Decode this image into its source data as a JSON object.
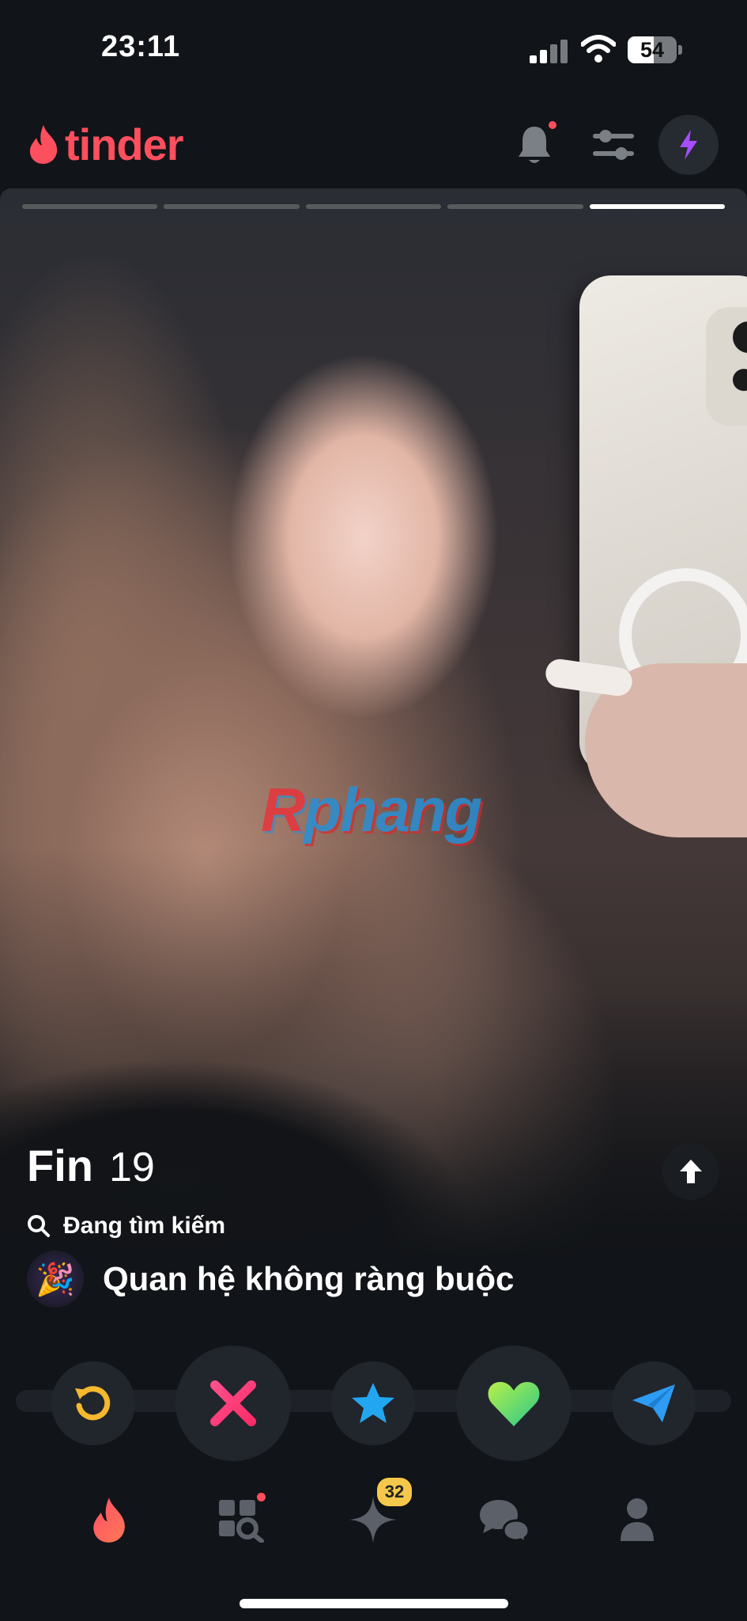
{
  "status_bar": {
    "time": "23:11",
    "battery_percent": "54",
    "battery_level": 0.54
  },
  "header": {
    "logo_text": "tinder",
    "notification_unread": true
  },
  "card": {
    "photo_count": 5,
    "active_photo_index": 4,
    "watermark": {
      "prefix": "R",
      "rest": "phang"
    },
    "profile": {
      "name": "Fin",
      "age": "19",
      "status_text": "Đang tìm kiếm",
      "intent_emoji": "🎉",
      "intent_text": "Quan hệ không ràng buộc"
    }
  },
  "actions": {
    "rewind": {
      "icon": "rewind-icon",
      "color": "#f5b82e"
    },
    "nope": {
      "icon": "close-icon",
      "color": "#fd4f8a"
    },
    "super_like": {
      "icon": "star-icon",
      "color": "#23a6f0"
    },
    "like": {
      "icon": "heart-icon",
      "color": "#5fe06e"
    },
    "boost_message": {
      "icon": "paper-plane-icon",
      "color": "#2f9cf4"
    }
  },
  "tabbar": {
    "tabs": [
      {
        "icon": "flame-icon",
        "active": true
      },
      {
        "icon": "explore-icon",
        "dot": true
      },
      {
        "icon": "sparkle-icon",
        "badge": "32"
      },
      {
        "icon": "chat-icon"
      },
      {
        "icon": "profile-icon"
      }
    ]
  },
  "colors": {
    "brand": "#fd4f5e",
    "background": "#111418"
  }
}
